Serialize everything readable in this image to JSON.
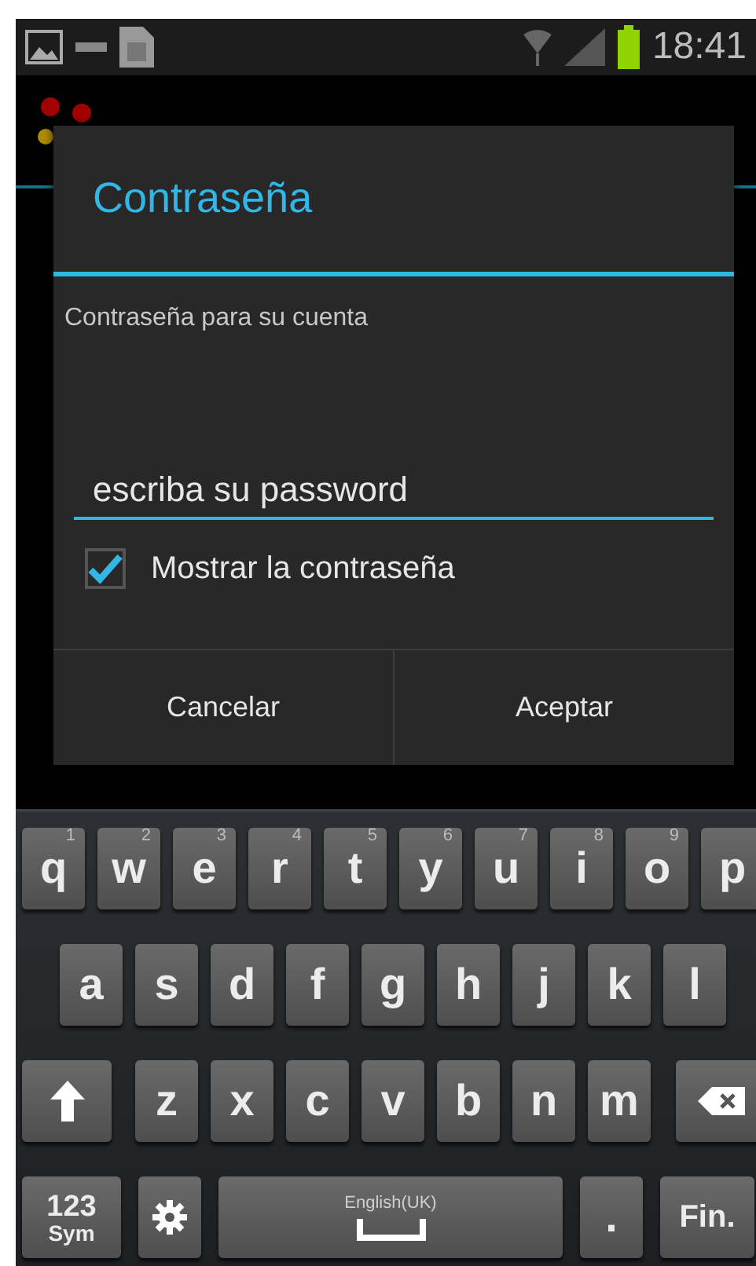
{
  "status_bar": {
    "time": "18:41"
  },
  "dialog": {
    "title": "Contraseña",
    "message": "Contraseña para su cuenta",
    "input": {
      "value": "escriba su password"
    },
    "checkbox": {
      "label": "Mostrar la contraseña",
      "checked": true
    },
    "buttons": [
      "Cancelar",
      "Aceptar"
    ]
  },
  "keyboard": {
    "rows": [
      {
        "keys": [
          {
            "kind": "char",
            "label": "q",
            "hint": "1"
          },
          {
            "kind": "char",
            "label": "w",
            "hint": "2"
          },
          {
            "kind": "char",
            "label": "e",
            "hint": "3"
          },
          {
            "kind": "char",
            "label": "r",
            "hint": "4"
          },
          {
            "kind": "char",
            "label": "t",
            "hint": "5"
          },
          {
            "kind": "char",
            "label": "y",
            "hint": "6"
          },
          {
            "kind": "char",
            "label": "u",
            "hint": "7"
          },
          {
            "kind": "char",
            "label": "i",
            "hint": "8"
          },
          {
            "kind": "char",
            "label": "o",
            "hint": "9"
          },
          {
            "kind": "char",
            "label": "p"
          }
        ]
      },
      {
        "keys": [
          {
            "kind": "char",
            "label": "a"
          },
          {
            "kind": "char",
            "label": "s"
          },
          {
            "kind": "char",
            "label": "d"
          },
          {
            "kind": "char",
            "label": "f"
          },
          {
            "kind": "char",
            "label": "g"
          },
          {
            "kind": "char",
            "label": "h"
          },
          {
            "kind": "char",
            "label": "j"
          },
          {
            "kind": "char",
            "label": "k"
          },
          {
            "kind": "char",
            "label": "l"
          }
        ]
      },
      {
        "keys": [
          {
            "kind": "shift"
          },
          {
            "kind": "char",
            "label": "z"
          },
          {
            "kind": "char",
            "label": "x"
          },
          {
            "kind": "char",
            "label": "c"
          },
          {
            "kind": "char",
            "label": "v"
          },
          {
            "kind": "char",
            "label": "b"
          },
          {
            "kind": "char",
            "label": "n"
          },
          {
            "kind": "char",
            "label": "m"
          },
          {
            "kind": "backspace"
          }
        ]
      },
      {
        "keys": [
          {
            "kind": "sym",
            "label": "123",
            "sub": "Sym"
          },
          {
            "kind": "settings"
          },
          {
            "kind": "space",
            "label": "English(UK)"
          },
          {
            "kind": "char",
            "label": "."
          },
          {
            "kind": "action",
            "label": "Fin."
          }
        ]
      }
    ]
  }
}
